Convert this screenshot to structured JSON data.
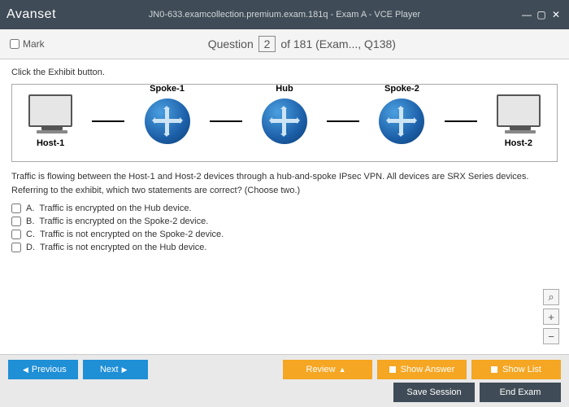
{
  "window": {
    "logo_text": "Avanset",
    "title": "JN0-633.examcollection.premium.exam.181q - Exam A - VCE Player"
  },
  "qbar": {
    "mark_label": "Mark",
    "question_word": "Question",
    "current": "2",
    "total_suffix": "of 181 (Exam..., Q138)"
  },
  "question": {
    "instruction": "Click the Exhibit button.",
    "scenario_line1": "Traffic is flowing between the Host-1 and Host-2 devices through a hub-and-spoke IPsec VPN. All devices are SRX Series devices.",
    "scenario_line2": "Referring to the exhibit, which two statements are correct? (Choose two.)"
  },
  "exhibit": {
    "host1": "Host-1",
    "spoke1": "Spoke-1",
    "hub": "Hub",
    "spoke2": "Spoke-2",
    "host2": "Host-2"
  },
  "options": [
    {
      "letter": "A.",
      "text": "Traffic is encrypted on the Hub device."
    },
    {
      "letter": "B.",
      "text": "Traffic is encrypted on the Spoke-2 device."
    },
    {
      "letter": "C.",
      "text": "Traffic is not encrypted on the Spoke-2 device."
    },
    {
      "letter": "D.",
      "text": "Traffic is not encrypted on the Hub device."
    }
  ],
  "buttons": {
    "previous": "Previous",
    "next": "Next",
    "review": "Review",
    "show_answer": "Show Answer",
    "show_list": "Show List",
    "save_session": "Save Session",
    "end_exam": "End Exam"
  }
}
